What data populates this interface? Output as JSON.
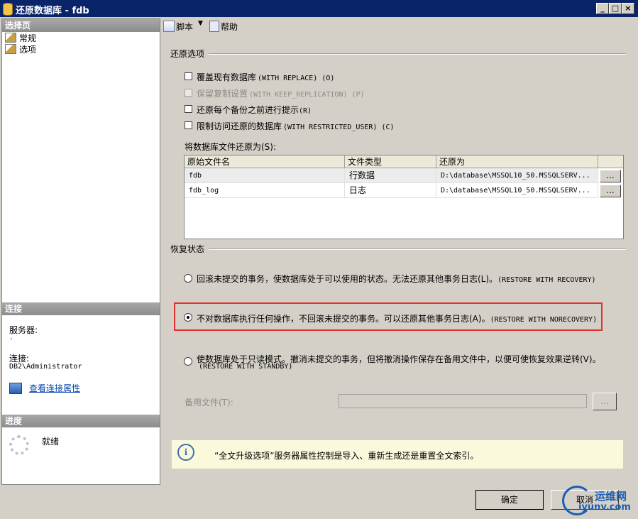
{
  "window": {
    "title": "还原数据库 - fdb"
  },
  "left": {
    "select_page_header": "选择页",
    "nav": [
      {
        "label": "常规"
      },
      {
        "label": "选项"
      }
    ],
    "connection_header": "连接",
    "server_label": "服务器:",
    "server_value": ".",
    "connection_label": "连接:",
    "connection_value": "DB2\\Administrator",
    "view_conn_link": "查看连接属性",
    "progress_header": "进度",
    "progress_status": "就绪"
  },
  "toolbar": {
    "script_label": "脚本",
    "help_label": "帮助"
  },
  "restore_options": {
    "group_label": "还原选项",
    "options": [
      {
        "label": "覆盖现有数据库",
        "suffix": "(WITH REPLACE) (O)",
        "enabled": true
      },
      {
        "label": "保留复制设置",
        "suffix": "(WITH KEEP_REPLICATION) (P)",
        "enabled": false
      },
      {
        "label": "还原每个备份之前进行提示",
        "suffix": "(R)",
        "enabled": true
      },
      {
        "label": "限制访问还原的数据库",
        "suffix": "(WITH RESTRICTED_USER) (C)",
        "enabled": true
      }
    ],
    "files_label": "将数据库文件还原为(S):",
    "columns": [
      "原始文件名",
      "文件类型",
      "还原为"
    ],
    "rows": [
      {
        "name": "fdb",
        "type": "行数据",
        "restore_as": "D:\\database\\MSSQL10_50.MSSQLSERV..."
      },
      {
        "name": "fdb_log",
        "type": "日志",
        "restore_as": "D:\\database\\MSSQL10_50.MSSQLSERV..."
      }
    ],
    "ellipsis": "..."
  },
  "recovery": {
    "group_label": "恢复状态",
    "opt1": "回滚未提交的事务，使数据库处于可以使用的状态。无法还原其他事务日志(L)。",
    "opt1_suffix": "(RESTORE WITH RECOVERY)",
    "opt2": "不对数据库执行任何操作，不回滚未提交的事务。可以还原其他事务日志(A)。",
    "opt2_suffix": "(RESTORE WITH NORECOVERY)",
    "opt3": "使数据库处于只读模式。撤消未提交的事务，但将撤消操作保存在备用文件中，以便可使恢复效果逆转(V)。",
    "opt3_suffix": "(RESTORE WITH STANDBY)",
    "selected": 2,
    "standby_label": "备用文件(T):",
    "standby_value": "",
    "highlight_color": "#e03030"
  },
  "info": {
    "text": "“全文升级选项”服务器属性控制是导入、重新生成还是重置全文索引。"
  },
  "buttons": {
    "ok": "确定",
    "cancel": "取消"
  },
  "watermark": {
    "title": "运维网",
    "url": "iyunv.com"
  }
}
